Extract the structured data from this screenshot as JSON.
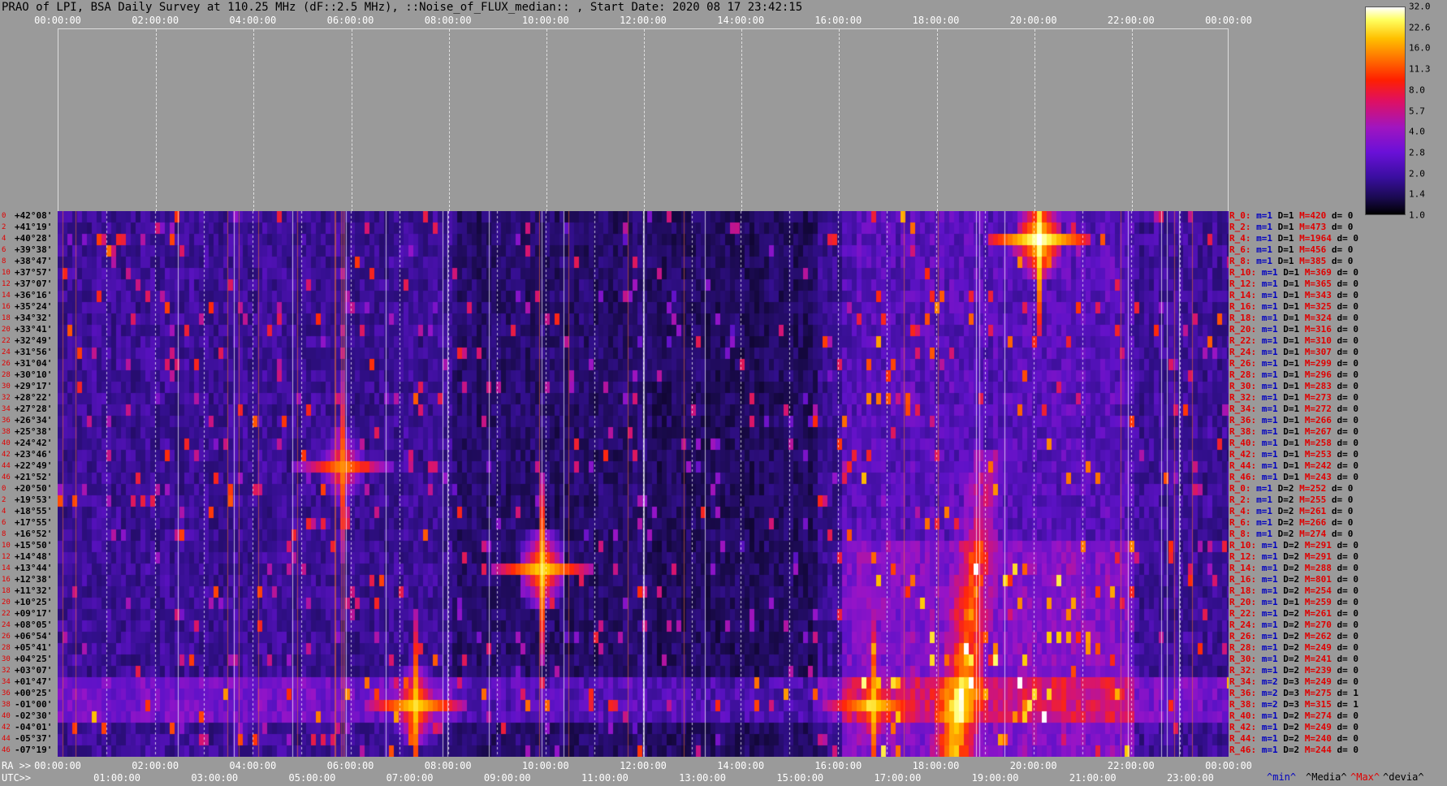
{
  "title": "PRAO of LPI, BSA Daily Survey at 110.25 MHz (dF::2.5 MHz), ::Noise_of_FLUX_median:: , Start Date: 2020 08 17 23:42:15",
  "ra_axis": {
    "prefix": "RA >>",
    "ticks": [
      "00:00:00",
      "02:00:00",
      "04:00:00",
      "06:00:00",
      "08:00:00",
      "10:00:00",
      "12:00:00",
      "14:00:00",
      "16:00:00",
      "18:00:00",
      "20:00:00",
      "22:00:00",
      "00:00:00"
    ]
  },
  "utc_axis": {
    "prefix": "UTC>>",
    "ticks": [
      "01:00:00",
      "03:00:00",
      "05:00:00",
      "07:00:00",
      "09:00:00",
      "11:00:00",
      "13:00:00",
      "15:00:00",
      "17:00:00",
      "19:00:00",
      "21:00:00",
      "23:00:00"
    ]
  },
  "colorbar": {
    "labels": [
      "32.0",
      "22.6",
      "16.0",
      "11.3",
      "8.0",
      "5.7",
      "4.0",
      "2.8",
      "2.0",
      "1.4",
      "1.0"
    ]
  },
  "declinations": [
    {
      "ri": "0",
      "dec": "+42°08'"
    },
    {
      "ri": "2",
      "dec": "+41°19'"
    },
    {
      "ri": "4",
      "dec": "+40°28'"
    },
    {
      "ri": "6",
      "dec": "+39°38'"
    },
    {
      "ri": "8",
      "dec": "+38°47'"
    },
    {
      "ri": "10",
      "dec": "+37°57'"
    },
    {
      "ri": "12",
      "dec": "+37°07'"
    },
    {
      "ri": "14",
      "dec": "+36°16'"
    },
    {
      "ri": "16",
      "dec": "+35°24'"
    },
    {
      "ri": "18",
      "dec": "+34°32'"
    },
    {
      "ri": "20",
      "dec": "+33°41'"
    },
    {
      "ri": "22",
      "dec": "+32°49'"
    },
    {
      "ri": "24",
      "dec": "+31°56'"
    },
    {
      "ri": "26",
      "dec": "+31°04'"
    },
    {
      "ri": "28",
      "dec": "+30°10'"
    },
    {
      "ri": "30",
      "dec": "+29°17'"
    },
    {
      "ri": "32",
      "dec": "+28°22'"
    },
    {
      "ri": "34",
      "dec": "+27°28'"
    },
    {
      "ri": "36",
      "dec": "+26°34'"
    },
    {
      "ri": "38",
      "dec": "+25°38'"
    },
    {
      "ri": "40",
      "dec": "+24°42'"
    },
    {
      "ri": "42",
      "dec": "+23°46'"
    },
    {
      "ri": "44",
      "dec": "+22°49'"
    },
    {
      "ri": "46",
      "dec": "+21°52'"
    },
    {
      "ri": "0",
      "dec": "+20°50'"
    },
    {
      "ri": "2",
      "dec": "+19°53'"
    },
    {
      "ri": "4",
      "dec": "+18°55'"
    },
    {
      "ri": "6",
      "dec": "+17°55'"
    },
    {
      "ri": "8",
      "dec": "+16°52'"
    },
    {
      "ri": "10",
      "dec": "+15°50'"
    },
    {
      "ri": "12",
      "dec": "+14°48'"
    },
    {
      "ri": "14",
      "dec": "+13°44'"
    },
    {
      "ri": "16",
      "dec": "+12°38'"
    },
    {
      "ri": "18",
      "dec": "+11°32'"
    },
    {
      "ri": "20",
      "dec": "+10°25'"
    },
    {
      "ri": "22",
      "dec": "+09°17'"
    },
    {
      "ri": "24",
      "dec": "+08°05'"
    },
    {
      "ri": "26",
      "dec": "+06°54'"
    },
    {
      "ri": "28",
      "dec": "+05°41'"
    },
    {
      "ri": "30",
      "dec": "+04°25'"
    },
    {
      "ri": "32",
      "dec": "+03°07'"
    },
    {
      "ri": "34",
      "dec": "+01°47'"
    },
    {
      "ri": "36",
      "dec": "+00°25'"
    },
    {
      "ri": "38",
      "dec": "-01°00'"
    },
    {
      "ri": "40",
      "dec": "-02°30'"
    },
    {
      "ri": "42",
      "dec": "-04°01'"
    },
    {
      "ri": "44",
      "dec": "-05°37'"
    },
    {
      "ri": "46",
      "dec": "-07°19'"
    }
  ],
  "row_stats": [
    {
      "r": "R_0:",
      "m": "m=1",
      "d": "D=1",
      "mx": "M=420",
      "dev": "d= 0"
    },
    {
      "r": "R_2:",
      "m": "m=1",
      "d": "D=1",
      "mx": "M=473",
      "dev": "d= 0"
    },
    {
      "r": "R_4:",
      "m": "m=1",
      "d": "D=1",
      "mx": "M=1964",
      "dev": "d= 0"
    },
    {
      "r": "R_6:",
      "m": "m=1",
      "d": "D=1",
      "mx": "M=456",
      "dev": "d= 0"
    },
    {
      "r": "R_8:",
      "m": "m=1",
      "d": "D=1",
      "mx": "M=385",
      "dev": "d= 0"
    },
    {
      "r": "R_10:",
      "m": "m=1",
      "d": "D=1",
      "mx": "M=369",
      "dev": "d= 0"
    },
    {
      "r": "R_12:",
      "m": "m=1",
      "d": "D=1",
      "mx": "M=365",
      "dev": "d= 0"
    },
    {
      "r": "R_14:",
      "m": "m=1",
      "d": "D=1",
      "mx": "M=343",
      "dev": "d= 0"
    },
    {
      "r": "R_16:",
      "m": "m=1",
      "d": "D=1",
      "mx": "M=325",
      "dev": "d= 0"
    },
    {
      "r": "R_18:",
      "m": "m=1",
      "d": "D=1",
      "mx": "M=324",
      "dev": "d= 0"
    },
    {
      "r": "R_20:",
      "m": "m=1",
      "d": "D=1",
      "mx": "M=316",
      "dev": "d= 0"
    },
    {
      "r": "R_22:",
      "m": "m=1",
      "d": "D=1",
      "mx": "M=310",
      "dev": "d= 0"
    },
    {
      "r": "R_24:",
      "m": "m=1",
      "d": "D=1",
      "mx": "M=307",
      "dev": "d= 0"
    },
    {
      "r": "R_26:",
      "m": "m=1",
      "d": "D=1",
      "mx": "M=299",
      "dev": "d= 0"
    },
    {
      "r": "R_28:",
      "m": "m=1",
      "d": "D=1",
      "mx": "M=296",
      "dev": "d= 0"
    },
    {
      "r": "R_30:",
      "m": "m=1",
      "d": "D=1",
      "mx": "M=283",
      "dev": "d= 0"
    },
    {
      "r": "R_32:",
      "m": "m=1",
      "d": "D=1",
      "mx": "M=273",
      "dev": "d= 0"
    },
    {
      "r": "R_34:",
      "m": "m=1",
      "d": "D=1",
      "mx": "M=272",
      "dev": "d= 0"
    },
    {
      "r": "R_36:",
      "m": "m=1",
      "d": "D=1",
      "mx": "M=266",
      "dev": "d= 0"
    },
    {
      "r": "R_38:",
      "m": "m=1",
      "d": "D=1",
      "mx": "M=267",
      "dev": "d= 0"
    },
    {
      "r": "R_40:",
      "m": "m=1",
      "d": "D=1",
      "mx": "M=258",
      "dev": "d= 0"
    },
    {
      "r": "R_42:",
      "m": "m=1",
      "d": "D=1",
      "mx": "M=253",
      "dev": "d= 0"
    },
    {
      "r": "R_44:",
      "m": "m=1",
      "d": "D=1",
      "mx": "M=242",
      "dev": "d= 0"
    },
    {
      "r": "R_46:",
      "m": "m=1",
      "d": "D=1",
      "mx": "M=243",
      "dev": "d= 0"
    },
    {
      "r": "R_0:",
      "m": "m=1",
      "d": "D=2",
      "mx": "M=252",
      "dev": "d= 0"
    },
    {
      "r": "R_2:",
      "m": "m=1",
      "d": "D=2",
      "mx": "M=255",
      "dev": "d= 0"
    },
    {
      "r": "R_4:",
      "m": "m=1",
      "d": "D=2",
      "mx": "M=261",
      "dev": "d= 0"
    },
    {
      "r": "R_6:",
      "m": "m=1",
      "d": "D=2",
      "mx": "M=266",
      "dev": "d= 0"
    },
    {
      "r": "R_8:",
      "m": "m=1",
      "d": "D=2",
      "mx": "M=274",
      "dev": "d= 0"
    },
    {
      "r": "R_10:",
      "m": "m=1",
      "d": "D=2",
      "mx": "M=291",
      "dev": "d= 0"
    },
    {
      "r": "R_12:",
      "m": "m=1",
      "d": "D=2",
      "mx": "M=291",
      "dev": "d= 0"
    },
    {
      "r": "R_14:",
      "m": "m=1",
      "d": "D=2",
      "mx": "M=288",
      "dev": "d= 0"
    },
    {
      "r": "R_16:",
      "m": "m=1",
      "d": "D=2",
      "mx": "M=801",
      "dev": "d= 0"
    },
    {
      "r": "R_18:",
      "m": "m=1",
      "d": "D=2",
      "mx": "M=254",
      "dev": "d= 0"
    },
    {
      "r": "R_20:",
      "m": "m=1",
      "d": "D=1",
      "mx": "M=259",
      "dev": "d= 0"
    },
    {
      "r": "R_22:",
      "m": "m=1",
      "d": "D=2",
      "mx": "M=261",
      "dev": "d= 0"
    },
    {
      "r": "R_24:",
      "m": "m=1",
      "d": "D=2",
      "mx": "M=270",
      "dev": "d= 0"
    },
    {
      "r": "R_26:",
      "m": "m=1",
      "d": "D=2",
      "mx": "M=262",
      "dev": "d= 0"
    },
    {
      "r": "R_28:",
      "m": "m=1",
      "d": "D=2",
      "mx": "M=249",
      "dev": "d= 0"
    },
    {
      "r": "R_30:",
      "m": "m=1",
      "d": "D=2",
      "mx": "M=241",
      "dev": "d= 0"
    },
    {
      "r": "R_32:",
      "m": "m=1",
      "d": "D=2",
      "mx": "M=239",
      "dev": "d= 0"
    },
    {
      "r": "R_34:",
      "m": "m=2",
      "d": "D=3",
      "mx": "M=249",
      "dev": "d= 0"
    },
    {
      "r": "R_36:",
      "m": "m=2",
      "d": "D=3",
      "mx": "M=275",
      "dev": "d= 1"
    },
    {
      "r": "R_38:",
      "m": "m=2",
      "d": "D=3",
      "mx": "M=315",
      "dev": "d= 1"
    },
    {
      "r": "R_40:",
      "m": "m=1",
      "d": "D=2",
      "mx": "M=274",
      "dev": "d= 0"
    },
    {
      "r": "R_42:",
      "m": "m=1",
      "d": "D=2",
      "mx": "M=249",
      "dev": "d= 0"
    },
    {
      "r": "R_44:",
      "m": "m=1",
      "d": "D=2",
      "mx": "M=240",
      "dev": "d= 0"
    },
    {
      "r": "R_46:",
      "m": "m=1",
      "d": "D=2",
      "mx": "M=244",
      "dev": "d= 0"
    }
  ],
  "legend": {
    "min": "^min^",
    "median": "^Media^",
    "max": "^Max^",
    "devia": "^devia^"
  },
  "colors": {
    "min": "#0000c0",
    "median": "#000000",
    "max": "#e00000",
    "devia": "#000000"
  },
  "chart_data": {
    "type": "heatmap",
    "title": "PRAO of LPI, BSA Daily Survey at 110.25 MHz (dF::2.5 MHz), ::Noise_of_FLUX_median:: , Start Date: 2020 08 17 23:42:15",
    "x_axis": "RA / UTC (hours)",
    "y_axis": "Declination (48 beams)",
    "color_scale": "log, 1.0 to 32.0",
    "hot_spots": [
      {
        "ra_hour": 19.97,
        "dec": "+40°28'",
        "level": 32
      },
      {
        "ra_hour": 9.9,
        "dec": "+13°44'",
        "level": 22.6
      },
      {
        "ra_hour": 7.3,
        "dec": "-01°00'",
        "level": 22.6
      },
      {
        "ra_hour": 16.6,
        "dec": "-01°00'",
        "level": 22.6
      },
      {
        "ra_hour": 5.8,
        "dec": "+22°49'",
        "level": 16.0
      }
    ]
  }
}
